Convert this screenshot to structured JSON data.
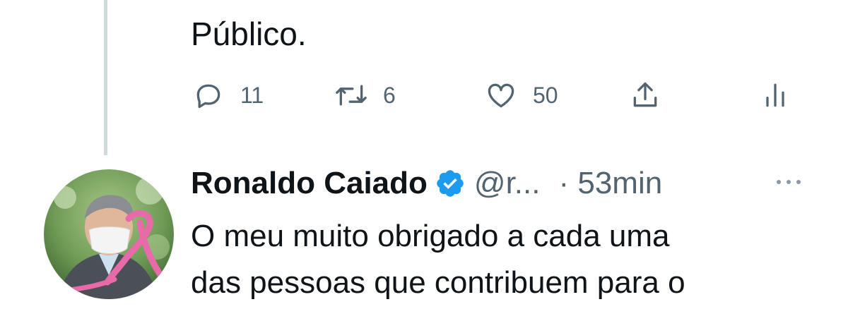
{
  "previous_tweet": {
    "text_last_line": "Público.",
    "actions": {
      "replies": "11",
      "retweets": "6",
      "likes": "50"
    },
    "icons": [
      "reply-icon",
      "retweet-icon",
      "like-icon",
      "share-icon",
      "analytics-icon"
    ]
  },
  "tweet": {
    "author_name": "Ronaldo Caiado",
    "handle": "@r...",
    "time": "· 53min",
    "verified": true,
    "text_lines": [
      "O meu muito obrigado a cada uma",
      "das pessoas que contribuem para o"
    ]
  },
  "colors": {
    "text": "#0f1419",
    "secondary": "#536471",
    "verified_blue": "#1d9bf0",
    "thread_line": "#cfd9de",
    "ribbon_pink": "#e86aa8"
  }
}
